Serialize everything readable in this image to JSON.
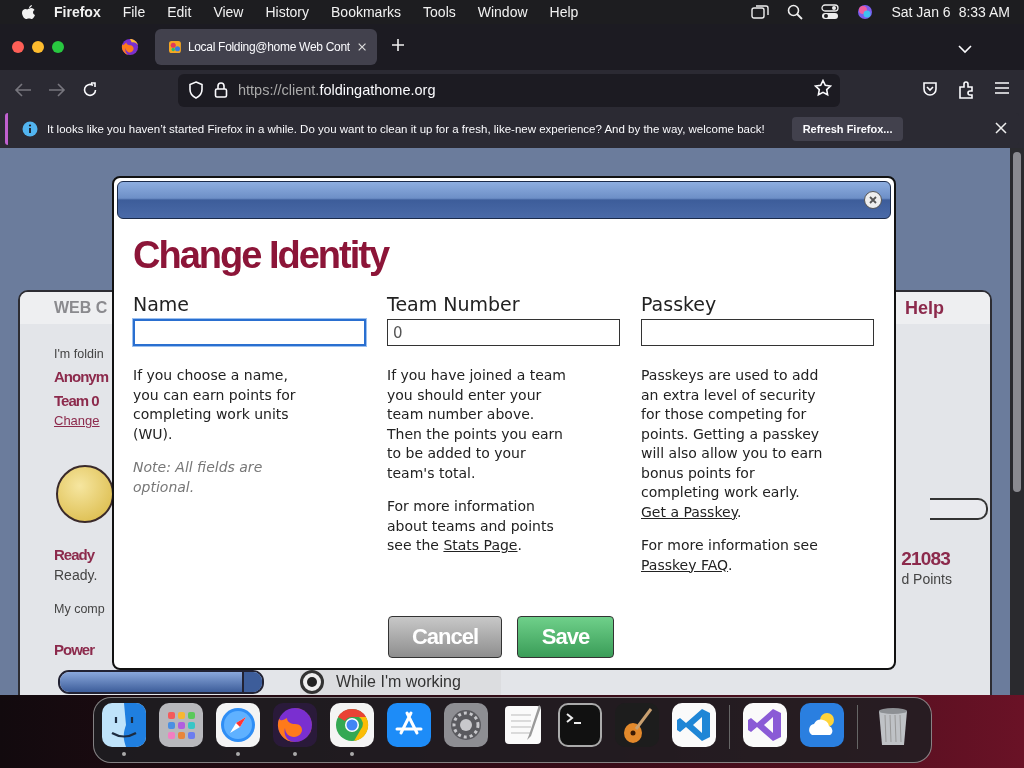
{
  "menubar": {
    "app": "Firefox",
    "items": [
      "File",
      "Edit",
      "View",
      "History",
      "Bookmarks",
      "Tools",
      "Window",
      "Help"
    ],
    "date": "Sat Jan 6",
    "time": "8:33 AM"
  },
  "tabs": [
    {
      "kind": "pinned",
      "selected": false
    },
    {
      "kind": "page",
      "title": "Local Folding@home Web Cont",
      "selected": true
    }
  ],
  "toolbar": {
    "url_prefix": "https://client.",
    "url_domain": "foldingathome.org"
  },
  "notification": {
    "text": "It looks like you haven’t started Firefox in a while. Do you want to clean it up for a fresh, like-new experience? And by the way, welcome back!",
    "button": "Refresh Firefox..."
  },
  "background_page": {
    "header_title": "WEB C",
    "help_link": "Help",
    "intro": "I'm foldin",
    "user_name": "Anonym",
    "team": "Team 0",
    "change_link": "Change",
    "status_title": "Ready",
    "status_text": "Ready.",
    "computer_text": "My comp",
    "power_title": "Power",
    "power_slider": {
      "level": 1
    },
    "points": "21083",
    "points_label": "d Points",
    "radio_label": "While I'm working",
    "radio_selected": true
  },
  "dialog": {
    "title": "Change Identity",
    "columns": [
      {
        "label": "Name",
        "focused": true,
        "paragraphs": [
          {
            "kind": "text",
            "parts": [
              {
                "kind": "text",
                "text": "If you choose a name, you can earn points for completing work units (WU)."
              }
            ]
          },
          {
            "kind": "note",
            "parts": [
              {
                "kind": "text",
                "text": "Note: All fields are optional."
              }
            ]
          }
        ]
      },
      {
        "label": "Team Number",
        "value": "0",
        "focused": false,
        "paragraphs": [
          {
            "kind": "text",
            "parts": [
              {
                "kind": "text",
                "text": "If you have joined a team you should enter your team number above. Then the points you earn to be added to your team's total."
              }
            ]
          },
          {
            "kind": "text",
            "parts": [
              {
                "kind": "text",
                "text": "For more information about teams and points see the "
              },
              {
                "kind": "link",
                "text": "Stats Page"
              },
              {
                "kind": "text",
                "text": "."
              }
            ]
          }
        ]
      },
      {
        "label": "Passkey",
        "focused": false,
        "paragraphs": [
          {
            "kind": "text",
            "parts": [
              {
                "kind": "text",
                "text": "Passkeys are used to add an extra level of security for those competing for points. Getting a passkey will also allow you to earn bonus points for completing work early. "
              },
              {
                "kind": "link",
                "text": "Get a Passkey"
              },
              {
                "kind": "text",
                "text": "."
              }
            ]
          },
          {
            "kind": "text",
            "parts": [
              {
                "kind": "text",
                "text": "For more information see "
              },
              {
                "kind": "link",
                "text": "Passkey FAQ"
              },
              {
                "kind": "text",
                "text": "."
              }
            ]
          }
        ]
      }
    ],
    "buttons": [
      {
        "label": "Cancel",
        "kind": "cancel"
      },
      {
        "label": "Save",
        "kind": "save"
      }
    ]
  },
  "dock": {
    "items": [
      {
        "kind": "finder",
        "running": true
      },
      {
        "kind": "launchpad",
        "running": false
      },
      {
        "kind": "safari",
        "running": true
      },
      {
        "kind": "firefox",
        "running": true
      },
      {
        "kind": "chrome",
        "running": true
      },
      {
        "kind": "appstore",
        "running": false
      },
      {
        "kind": "settings",
        "running": false
      },
      {
        "kind": "textedit",
        "running": false
      },
      {
        "kind": "terminal",
        "running": false
      },
      {
        "kind": "garageband",
        "running": false
      },
      {
        "kind": "vscode",
        "running": false
      },
      {
        "kind": "separator"
      },
      {
        "kind": "visualstudio",
        "running": false
      },
      {
        "kind": "weather",
        "running": false
      },
      {
        "kind": "separator"
      },
      {
        "kind": "trash",
        "running": false
      }
    ]
  }
}
